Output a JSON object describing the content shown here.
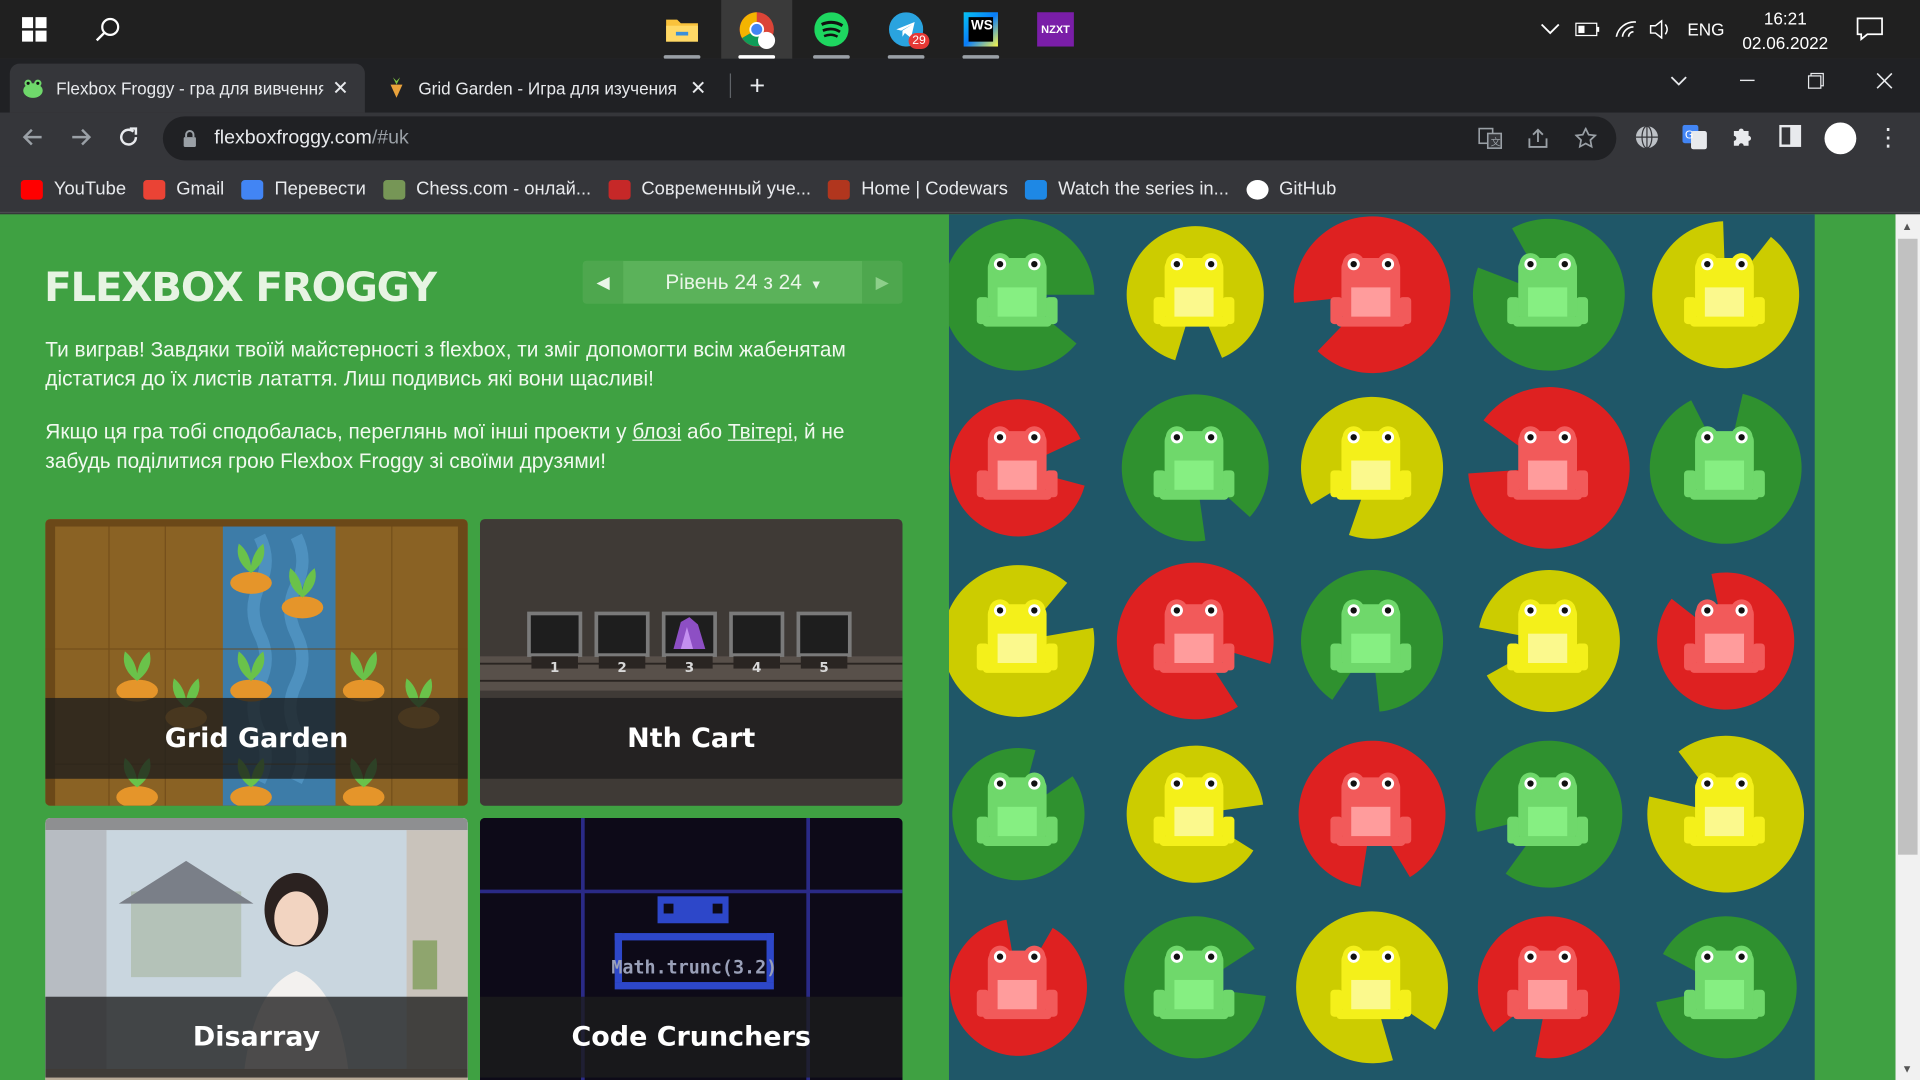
{
  "taskbar": {
    "apps": [
      {
        "name": "file-explorer"
      },
      {
        "name": "chrome"
      },
      {
        "name": "spotify"
      },
      {
        "name": "telegram",
        "badge": "29"
      },
      {
        "name": "webstorm",
        "label": "WS"
      },
      {
        "name": "nzxt",
        "label": "NZXT"
      }
    ],
    "tray": {
      "language": "ENG"
    },
    "clock": {
      "time": "16:21",
      "date": "02.06.2022"
    }
  },
  "browser": {
    "tabs": [
      {
        "title": "Flexbox Froggy - гра для вивчення CSS flexbox",
        "active": true,
        "close": "✕"
      },
      {
        "title": "Grid Garden - Игра для изучения CSS grid",
        "active": false,
        "close": "✕"
      }
    ],
    "new_tab": "+",
    "url": {
      "host": "flexboxfroggy.com",
      "path": "/#uk"
    },
    "bookmarks": [
      {
        "label": "YouTube",
        "icon": "youtube-icon",
        "color": "#ff0000"
      },
      {
        "label": "Gmail",
        "icon": "gmail-icon",
        "color": "#ea4335"
      },
      {
        "label": "Перевести",
        "icon": "translate-icon",
        "color": "#4285f4"
      },
      {
        "label": "Chess.com - онлай...",
        "icon": "chess-icon",
        "color": "#769656"
      },
      {
        "label": "Современный уче...",
        "icon": "learnjs-icon",
        "color": "#c62828"
      },
      {
        "label": "Home | Codewars",
        "icon": "codewars-icon",
        "color": "#b1361e"
      },
      {
        "label": "Watch the series in...",
        "icon": "series-icon",
        "color": "#1e88e5"
      },
      {
        "label": "GitHub",
        "icon": "github-icon",
        "color": "#ffffff"
      }
    ]
  },
  "game": {
    "logo": "FLEXBOX FROGGY",
    "level": {
      "label": "Рівень 24 з 24",
      "prev": "◀",
      "next": "▶",
      "caret": "▾"
    },
    "message": {
      "p1": "Ти виграв! Завдяки твоїй майстерності з flexbox, ти зміг допомогти всім жабенятам дістатися до їх листів латаття. Лиш подивись які вони щасливі!",
      "p2_before": "Якщо ця гра тобі сподобалась, переглянь мої інші проекти у ",
      "p2_link1": "блозі",
      "p2_middle": " або ",
      "p2_link2": "Твітері",
      "p2_after": ", й не забудь поділитися грою Flexbox Froggy зі своїми друзями!"
    },
    "projects": [
      {
        "title": "Grid Garden"
      },
      {
        "title": "Nth Cart",
        "cart_numbers": [
          "1",
          "2",
          "3",
          "4",
          "5"
        ]
      },
      {
        "title": "Disarray"
      },
      {
        "title": "Code Crunchers",
        "code": "Math.trunc(3.2)"
      }
    ],
    "colors": {
      "green": {
        "pad": "#2f912f",
        "frog": "#6fd86b",
        "belly": "#86ef82"
      },
      "yellow": {
        "pad": "#cccc00",
        "frog": "#f4f01a",
        "belly": "#fbf98d"
      },
      "red": {
        "pad": "#de2121",
        "frog": "#f25a5a",
        "belly": "#ff9c9c"
      }
    },
    "grid": [
      [
        "green",
        "yellow",
        "red",
        "green",
        "yellow"
      ],
      [
        "red",
        "green",
        "yellow",
        "red",
        "green"
      ],
      [
        "yellow",
        "red",
        "green",
        "yellow",
        "red"
      ],
      [
        "green",
        "yellow",
        "red",
        "green",
        "yellow"
      ],
      [
        "red",
        "green",
        "yellow",
        "red",
        "green"
      ]
    ]
  }
}
